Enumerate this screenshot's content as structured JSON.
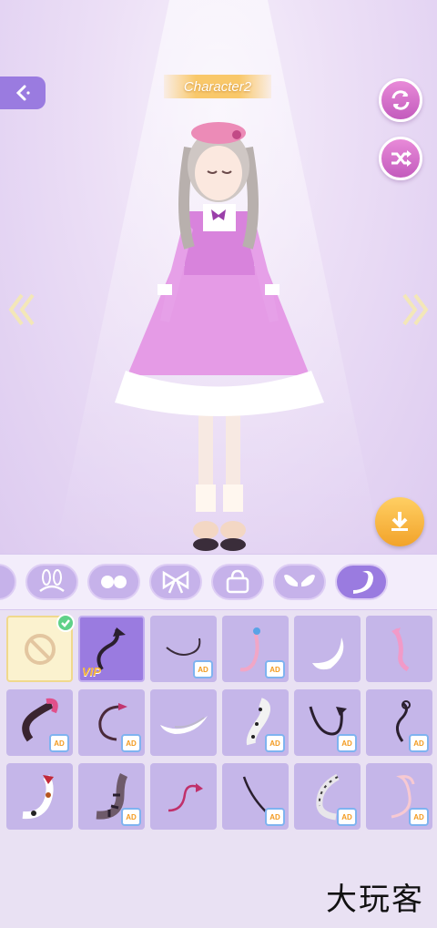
{
  "header": {
    "character_name": "Character2"
  },
  "icons": {
    "back": "back-arrow-icon",
    "reset": "refresh-icon",
    "random": "shuffle-icon",
    "prev": "double-chevron-left-icon",
    "next": "double-chevron-right-icon",
    "download": "download-icon"
  },
  "tabs": [
    {
      "name": "tab-partial",
      "icon": "partial-icon"
    },
    {
      "name": "tab-ears",
      "icon": "bunny-ears-icon"
    },
    {
      "name": "tab-eyes",
      "icon": "eyes-icon"
    },
    {
      "name": "tab-bows",
      "icon": "bow-icon"
    },
    {
      "name": "tab-bags",
      "icon": "handbag-icon"
    },
    {
      "name": "tab-wings",
      "icon": "wings-icon"
    },
    {
      "name": "tab-tails",
      "icon": "tail-icon",
      "active": true
    }
  ],
  "grid": {
    "items": [
      {
        "type": "none",
        "equipped": true
      },
      {
        "type": "vip",
        "badge": "VIP"
      },
      {
        "type": "ad",
        "badge": "AD"
      },
      {
        "type": "ad",
        "badge": "AD"
      },
      {
        "type": "free"
      },
      {
        "type": "free"
      },
      {
        "type": "ad",
        "badge": "AD"
      },
      {
        "type": "ad",
        "badge": "AD"
      },
      {
        "type": "free"
      },
      {
        "type": "ad",
        "badge": "AD"
      },
      {
        "type": "ad",
        "badge": "AD"
      },
      {
        "type": "ad",
        "badge": "AD"
      },
      {
        "type": "free"
      },
      {
        "type": "ad",
        "badge": "AD"
      },
      {
        "type": "free"
      },
      {
        "type": "ad",
        "badge": "AD"
      },
      {
        "type": "ad",
        "badge": "AD"
      },
      {
        "type": "ad",
        "badge": "AD"
      }
    ]
  },
  "watermark": "大玩客",
  "colors": {
    "accent": "#9a7be0",
    "button_pink": "#d772cc",
    "download_orange": "#f5b33f",
    "panel": "#e9e1f3"
  }
}
